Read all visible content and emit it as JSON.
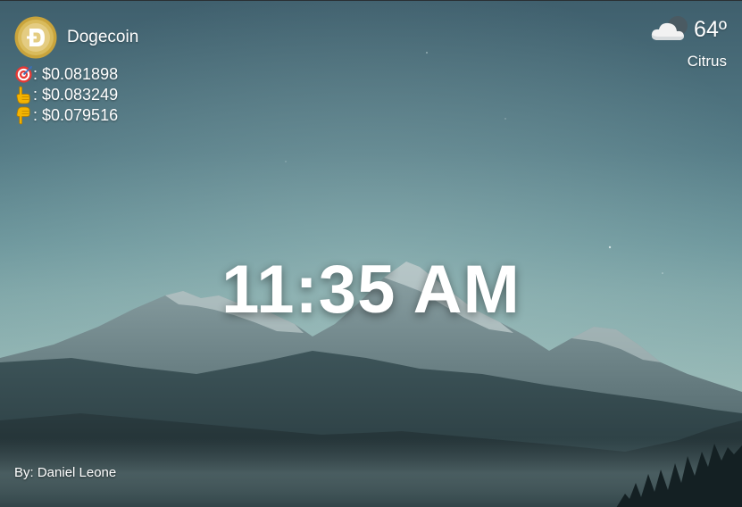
{
  "crypto": {
    "coin_name": "Dogecoin",
    "logo_icon": "dogecoin-logo-icon",
    "current": {
      "icon": "target-icon",
      "label": ": $0.081898"
    },
    "high": {
      "icon": "pointing-up-icon",
      "label": ": $0.083249"
    },
    "low": {
      "icon": "pointing-down-icon",
      "label": ": $0.079516"
    }
  },
  "weather": {
    "icon": "cloud-night-icon",
    "temperature": "64º",
    "location": "Citrus"
  },
  "clock": {
    "time": "11:35 AM"
  },
  "credit": {
    "text": "By: Daniel Leone"
  },
  "colors": {
    "sky_top": "#3f5f6d",
    "sky_bottom": "#a3c2bd",
    "mountain_dark": "#1f2f33",
    "coin_gold": "#c9a43c"
  }
}
